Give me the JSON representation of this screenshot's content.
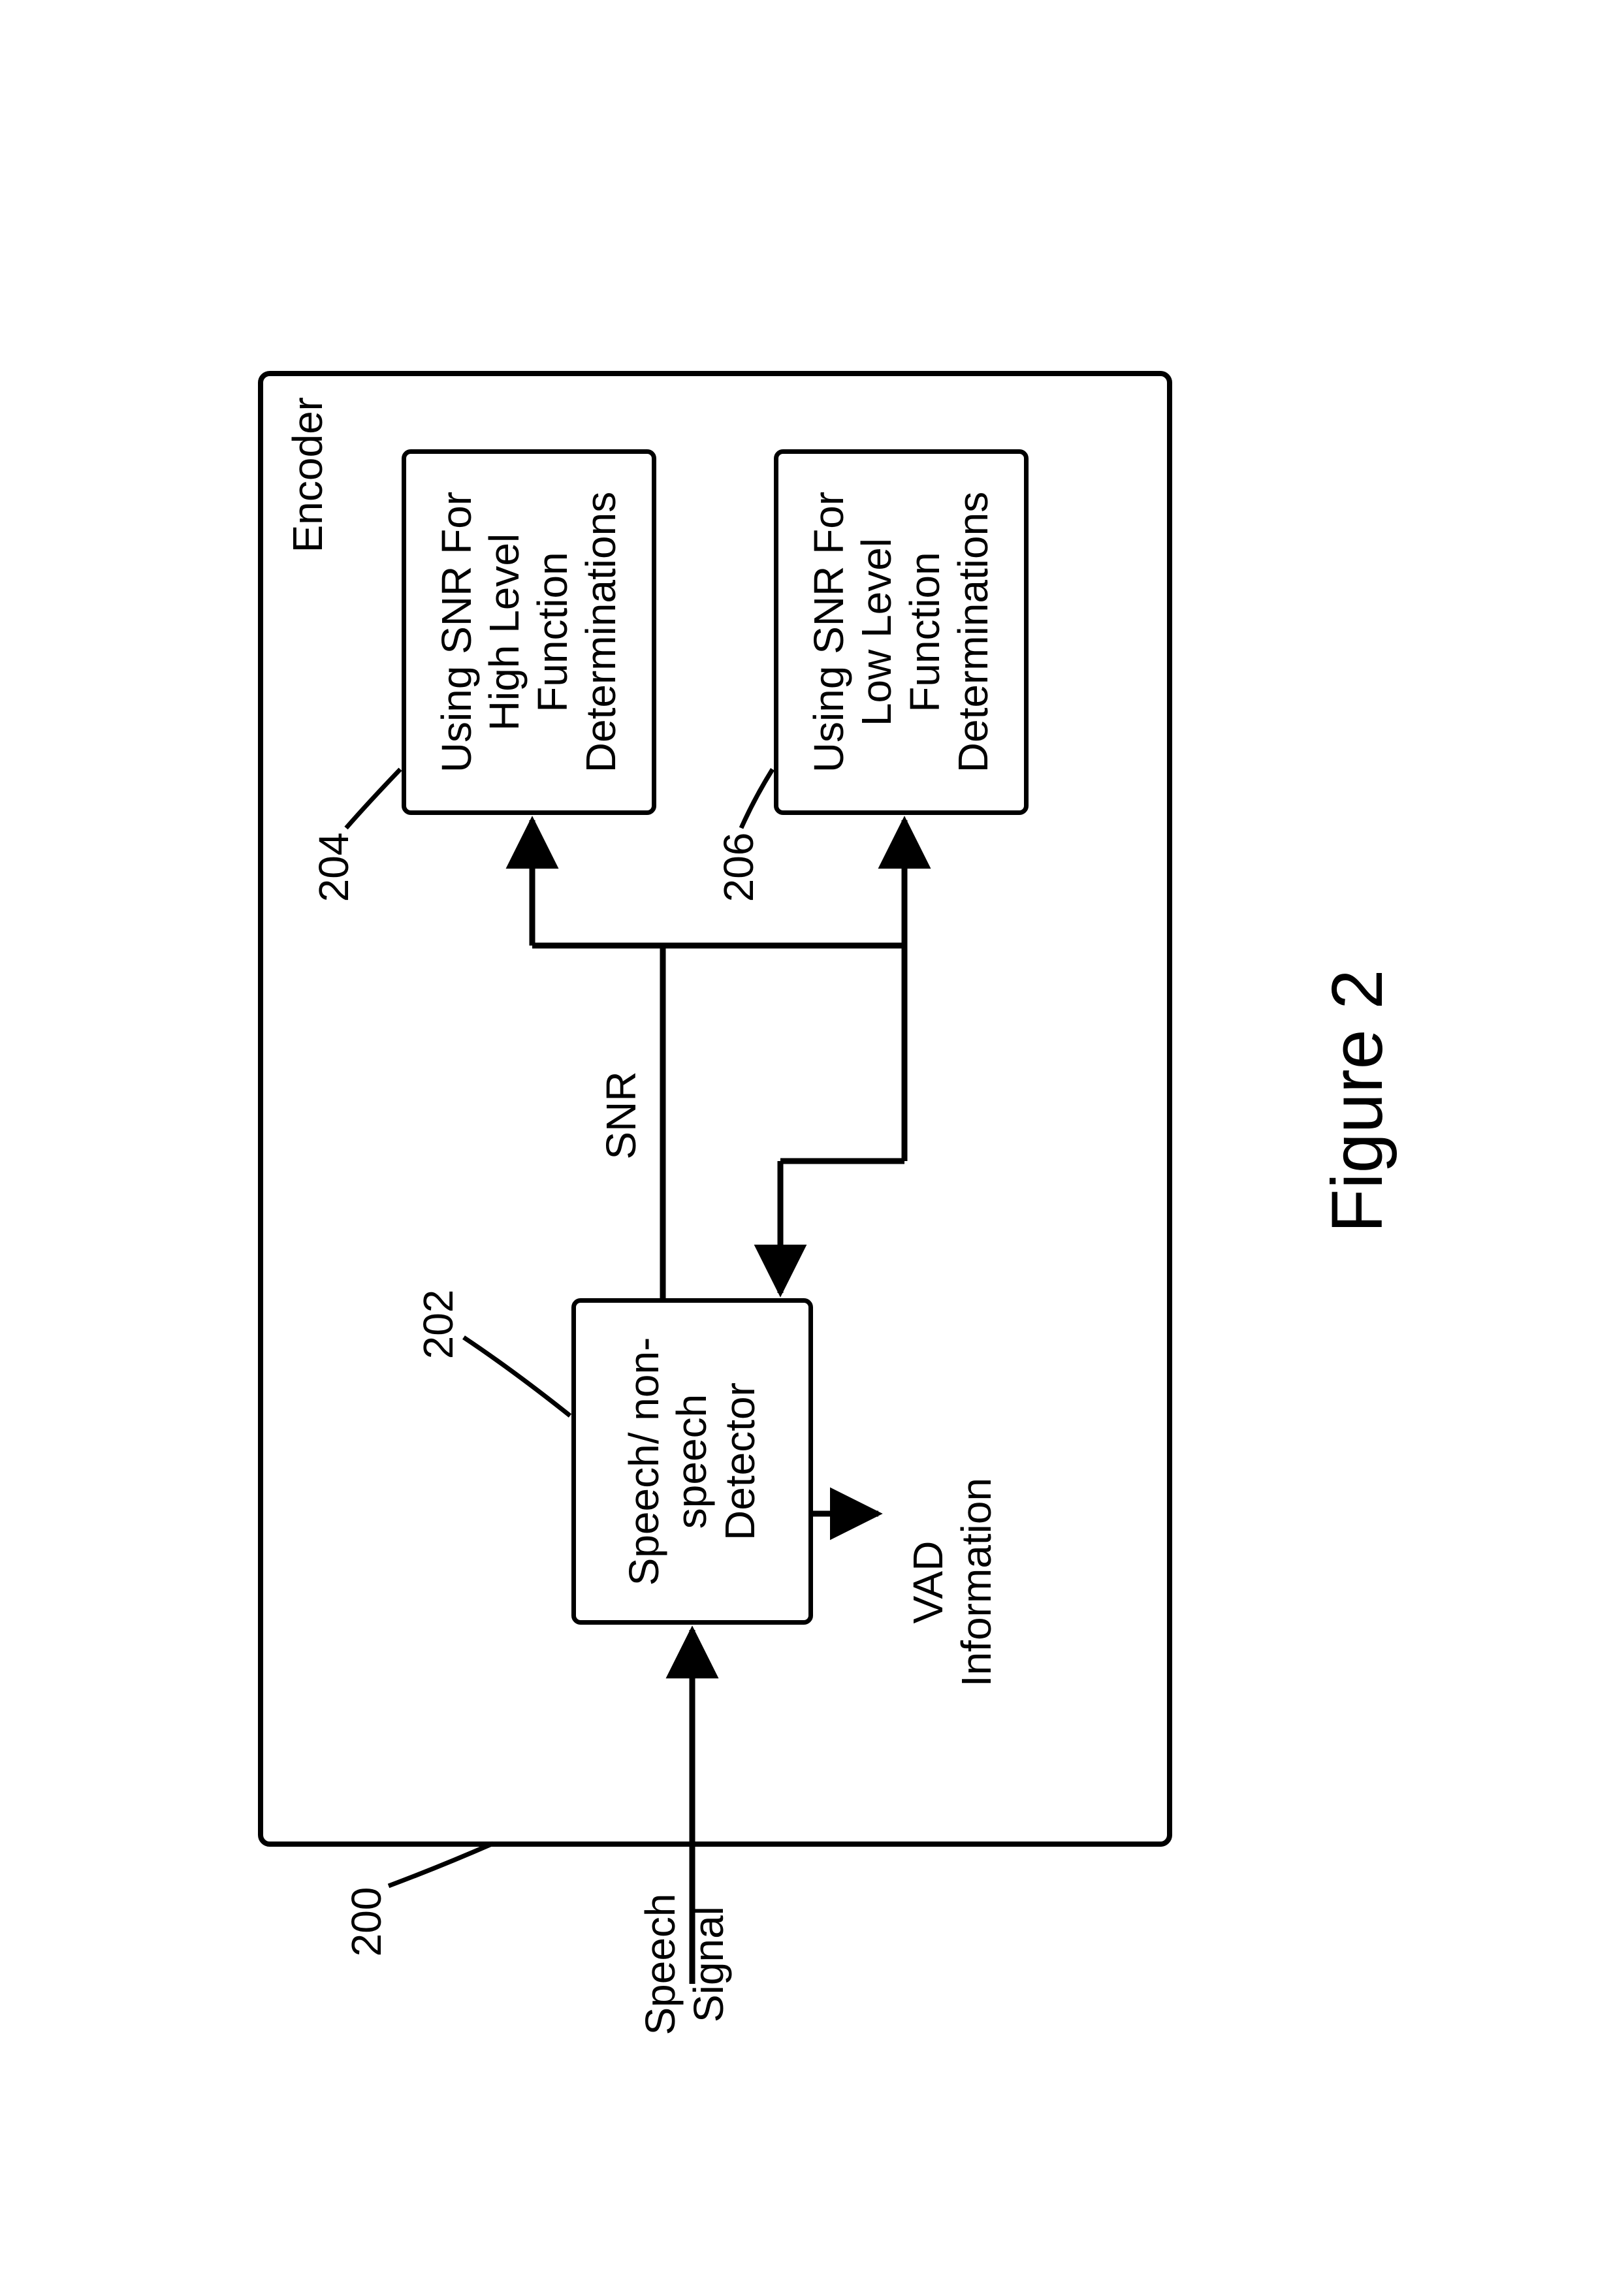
{
  "figure": {
    "caption": "Figure 2",
    "encoder_label": "Encoder"
  },
  "io": {
    "speech_signal": "Speech\nSignal",
    "vad_info": "VAD\nInformation",
    "snr_label": "SNR"
  },
  "refs": {
    "r200": "200",
    "r202": "202",
    "r204": "204",
    "r206": "206"
  },
  "blocks": {
    "detector": "Speech/\nnon-speech\nDetector",
    "high": "Using SNR\nFor High Level\nFunction\nDeterminations",
    "low": "Using SNR\nFor Low Level\nFunction\nDeterminations"
  }
}
